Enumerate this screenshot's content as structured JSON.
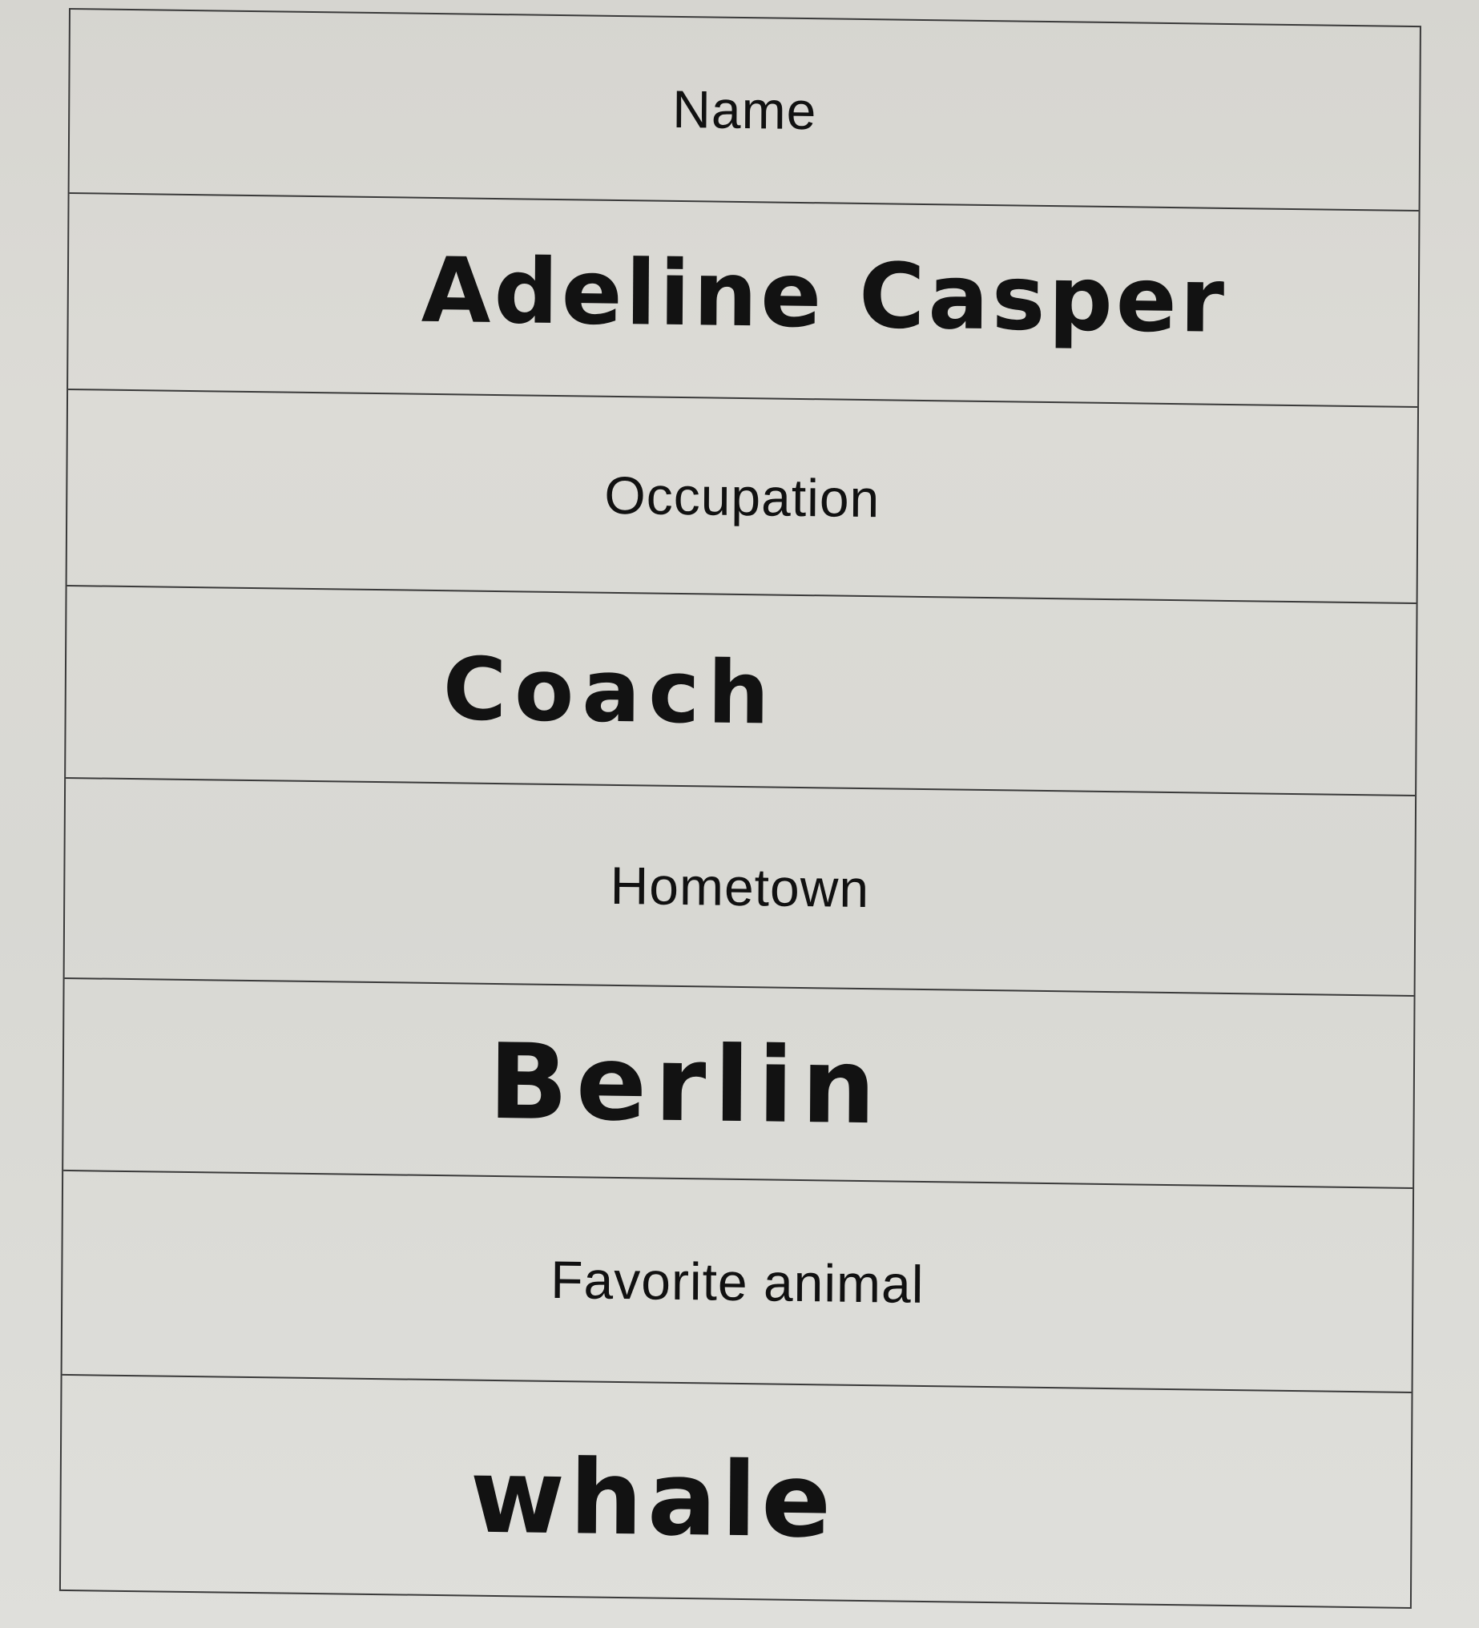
{
  "form": {
    "fields": [
      {
        "label": "Name",
        "value": "Adeline Casper"
      },
      {
        "label": "Occupation",
        "value": "Coach"
      },
      {
        "label": "Hometown",
        "value": "Berlin"
      },
      {
        "label": "Favorite animal",
        "value": "whale"
      }
    ]
  }
}
